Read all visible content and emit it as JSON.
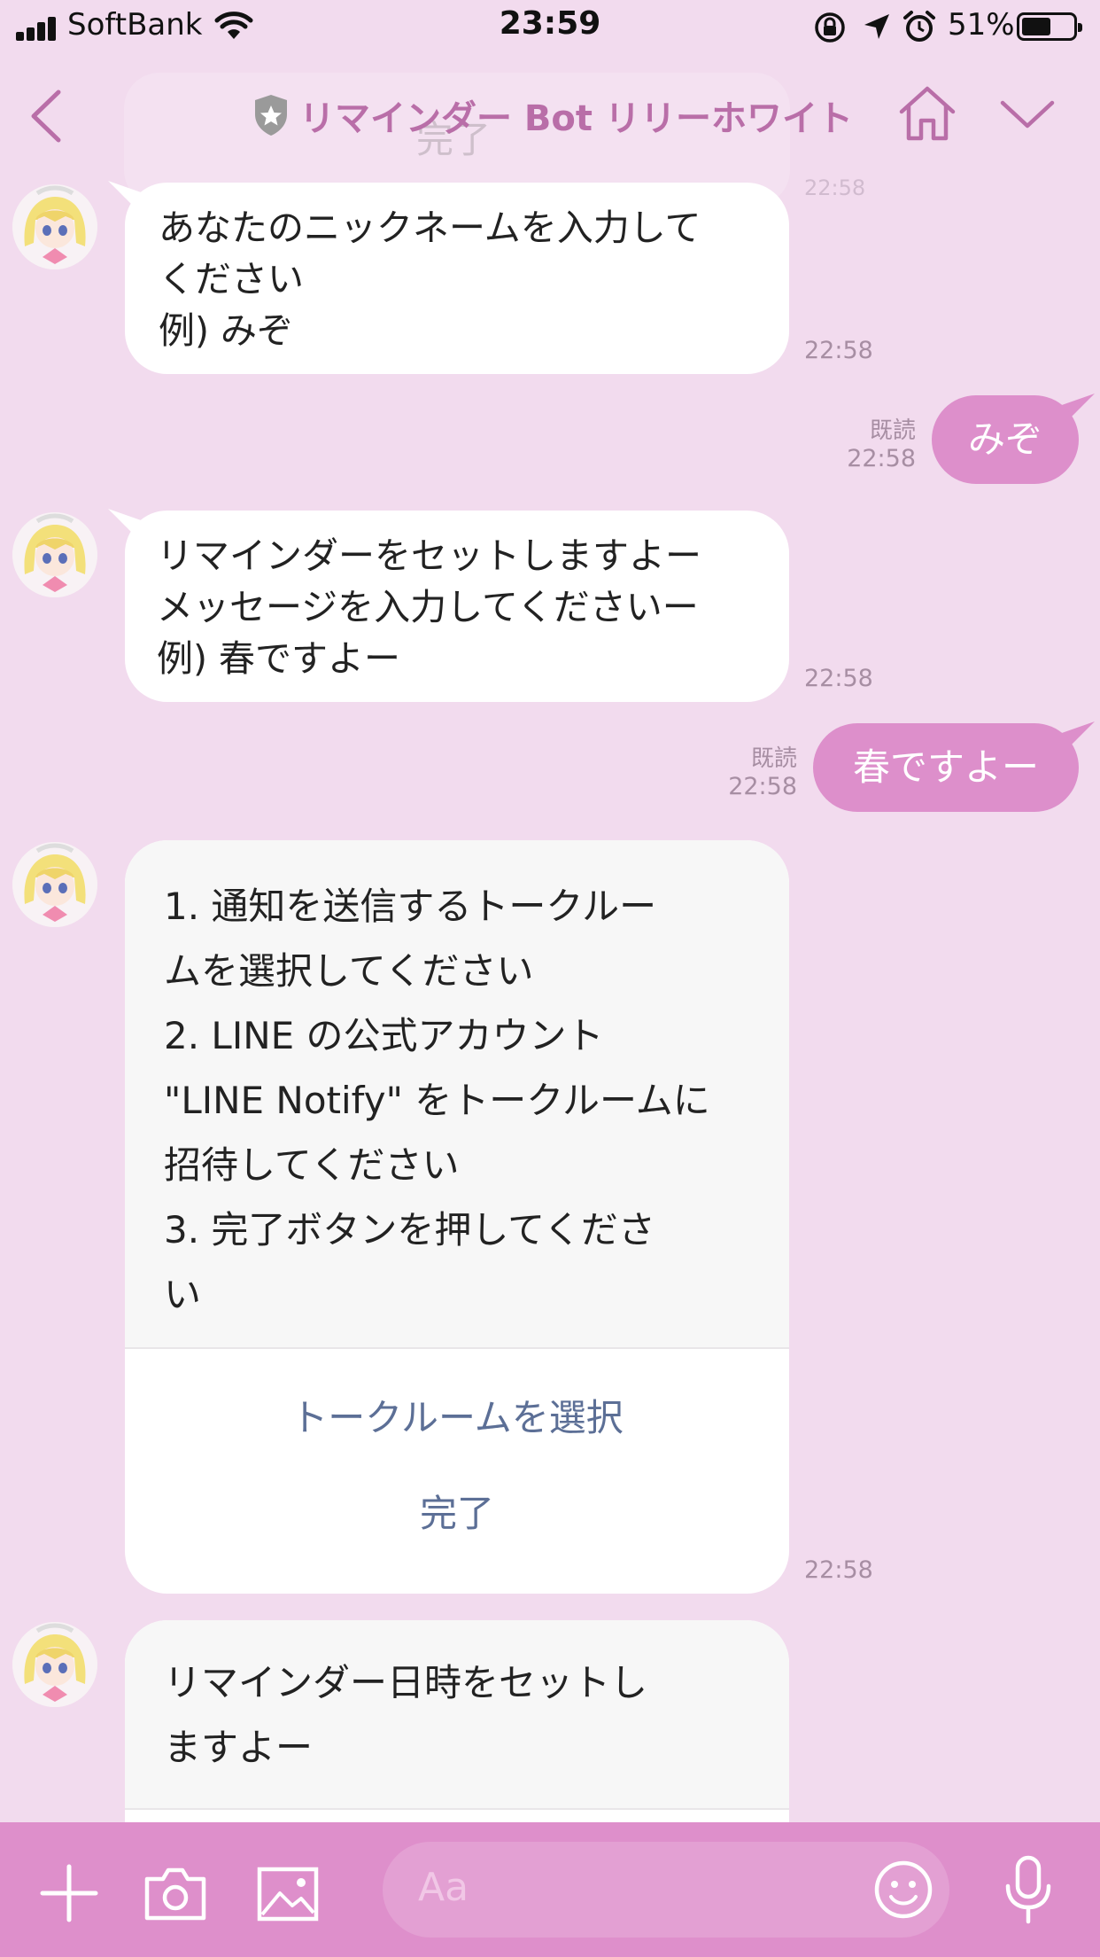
{
  "status_bar": {
    "carrier": "SoftBank",
    "time": "23:59",
    "battery": "51%",
    "battery_level": 0.51
  },
  "header": {
    "title": "リマインダー Bot リリーホワイト",
    "behind_header": {
      "text": "完了",
      "time": "22:58"
    }
  },
  "messages": [
    {
      "from": "bot",
      "text": "あなたのニックネームを入力して\nください\n例) みぞ",
      "time": "22:58"
    },
    {
      "from": "me",
      "text": "みぞ",
      "read": "既読",
      "time": "22:58"
    },
    {
      "from": "bot",
      "text": "リマインダーをセットしますよー\nメッセージを入力してくださいー\n例) 春ですよー",
      "time": "22:58"
    },
    {
      "from": "me",
      "text": "春ですよー",
      "read": "既読",
      "time": "22:58"
    }
  ],
  "card": {
    "text": "1. 通知を送信するトークルー\nムを選択してください\n2. LINE の公式アカウント\n\"LINE Notify\" をトークルームに\n招待してください\n3. 完了ボタンを押してくださ\nい",
    "actions": [
      "トークルームを選択",
      "完了"
    ],
    "time": "22:58"
  },
  "last_card": {
    "text": "リマインダー日時をセットし\nますよー"
  },
  "input": {
    "placeholder": "Aa"
  },
  "colors": {
    "background": "#f2dbee",
    "accent": "#de8fcb",
    "title": "#b96ea8",
    "link": "#5c6f96"
  }
}
